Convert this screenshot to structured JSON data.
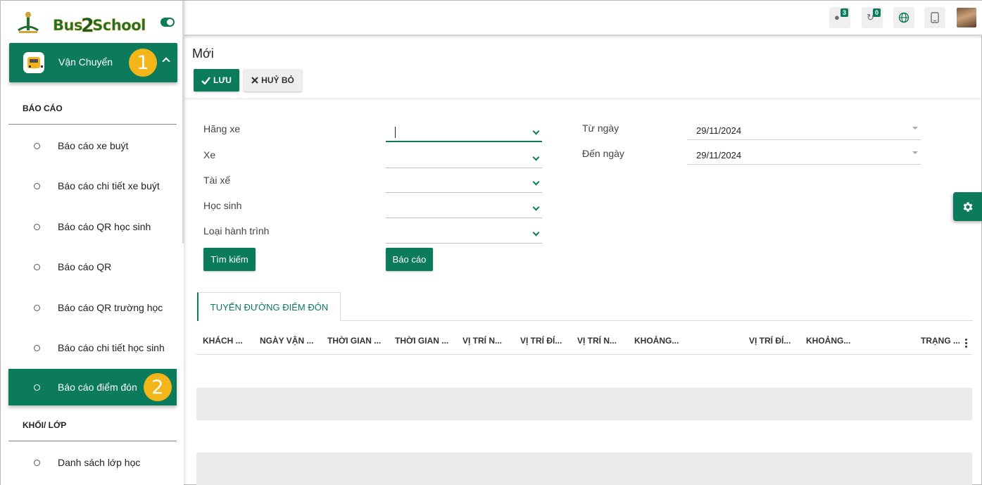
{
  "brand": {
    "logo_text_a": "Bus",
    "logo_text_b": "2",
    "logo_text_c": "School"
  },
  "module": {
    "label": "Vận Chuyển",
    "badge": "1"
  },
  "sidebar": {
    "sections": [
      {
        "title": "BÁO CÁO"
      },
      {
        "title": "KHỐI/ LỚP"
      }
    ],
    "items": [
      {
        "label": "Báo cáo xe buýt"
      },
      {
        "label": "Báo cáo chi tiết xe buýt"
      },
      {
        "label": "Báo cáo QR học sinh"
      },
      {
        "label": "Báo cáo QR"
      },
      {
        "label": "Báo cáo QR trường học"
      },
      {
        "label": "Báo cáo chi tiết học sinh"
      },
      {
        "label": "Báo cáo điểm đón",
        "active": true,
        "badge": "2"
      },
      {
        "label": "Danh sách lớp học"
      }
    ]
  },
  "topbar": {
    "messages_count": "3",
    "activities_count": "0",
    "icons": [
      "chat-icon",
      "activity-icon",
      "globe-icon",
      "tablet-icon",
      "avatar"
    ]
  },
  "page": {
    "title": "Mới",
    "save_label": "LƯU",
    "cancel_label": "HUỶ BỎ"
  },
  "form": {
    "left_fields": [
      {
        "label": "Hãng xe",
        "value": ""
      },
      {
        "label": "Xe",
        "value": ""
      },
      {
        "label": "Tài xế",
        "value": ""
      },
      {
        "label": "Học sinh",
        "value": ""
      },
      {
        "label": "Loại hành trình",
        "value": ""
      }
    ],
    "from_date": {
      "label": "Từ ngày",
      "value": "29/11/2024"
    },
    "to_date": {
      "label": "Đến ngày",
      "value": "29/11/2024"
    },
    "search_label": "Tìm kiếm",
    "report_label": "Báo cáo"
  },
  "tab": {
    "label": "TUYẾN ĐƯỜNG ĐIỂM ĐÓN"
  },
  "table": {
    "columns": [
      "KHÁCH ...",
      "NGÀY VẬN ...",
      "THỜI GIAN ...",
      "THỜI GIAN ...",
      "VỊ TRÍ N...",
      "VỊ TRÍ ĐÍ...",
      "VỊ TRÍ N...",
      "KHOẢNG...",
      "VỊ TRÍ ĐÍ...",
      "KHOẢNG...",
      "TRẠNG ..."
    ]
  },
  "colors": {
    "primary": "#0b7b5b",
    "badge": "#f4b518",
    "stripe": "#ebebeb"
  }
}
